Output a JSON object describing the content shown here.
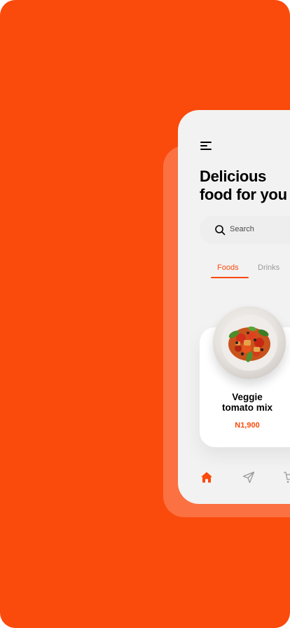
{
  "colors": {
    "accent": "#FA4A0C",
    "screen_bg": "#F2F2F2",
    "card_bg": "#FFFFFF",
    "muted_text": "#9A9A9D"
  },
  "header": {
    "menu_icon": "hamburger-menu-icon",
    "title_line1": "Delicious",
    "title_line2": "food for you"
  },
  "search": {
    "icon": "search-icon",
    "placeholder": "Search"
  },
  "tabs": [
    {
      "label": "Foods",
      "active": true
    },
    {
      "label": "Drinks",
      "active": false
    }
  ],
  "food_card": {
    "name_line1": "Veggie",
    "name_line2": "tomato mix",
    "price": "N1,900"
  },
  "bottom_nav": [
    {
      "icon": "home-icon",
      "active": true
    },
    {
      "icon": "send-icon",
      "active": false
    },
    {
      "icon": "cart-icon",
      "active": false
    }
  ]
}
